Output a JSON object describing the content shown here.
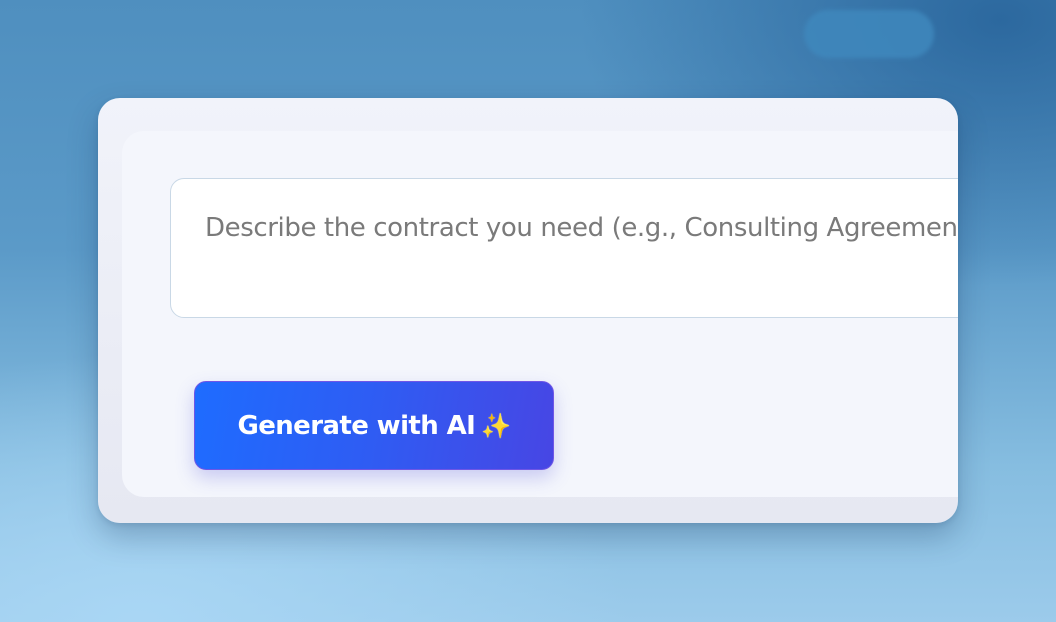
{
  "prompt": {
    "placeholder": "Describe the contract you need (e.g., Consulting Agreement",
    "value": ""
  },
  "generate_button": {
    "label": "Generate with AI",
    "icon": "sparkles-icon",
    "icon_glyph": "✨",
    "color_start": "#1e6cff",
    "color_end": "#4746e4"
  }
}
